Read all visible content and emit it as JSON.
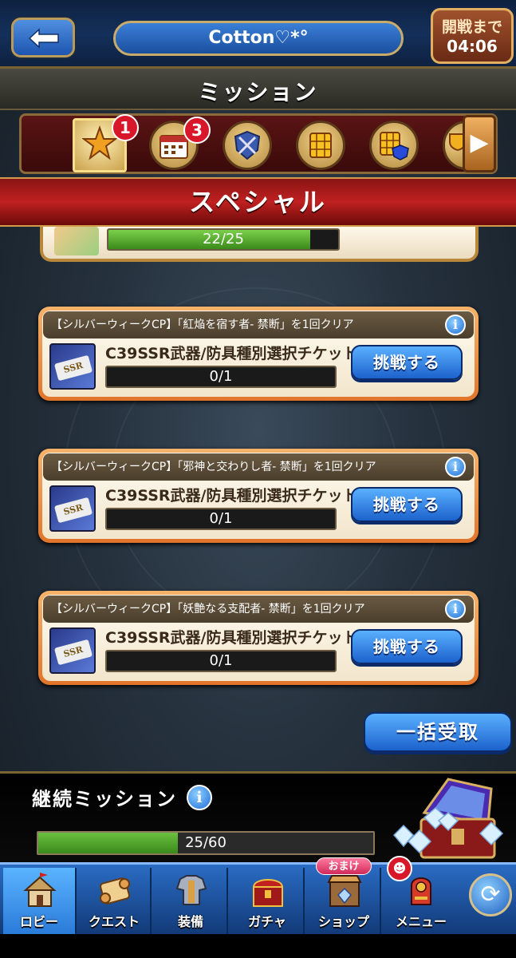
{
  "header": {
    "player_name": "Cotton♡*°",
    "timer_label": "開戦まで",
    "timer_value": "04:06"
  },
  "page_title": "ミッション",
  "tabs": [
    {
      "name": "special",
      "icon": "star-icon",
      "badge": "1",
      "active": true
    },
    {
      "name": "daily",
      "icon": "calendar-icon",
      "badge": "3",
      "active": false
    },
    {
      "name": "battle",
      "icon": "shield-swords-icon",
      "badge": "",
      "active": false
    },
    {
      "name": "panel",
      "icon": "grid-panel-icon",
      "badge": "",
      "active": false
    },
    {
      "name": "panel-gem",
      "icon": "grid-gem-icon",
      "badge": "",
      "active": false
    },
    {
      "name": "trophy",
      "icon": "trophy-icon",
      "badge": "",
      "active": false
    }
  ],
  "category_banner": "スペシャル",
  "partial_mission": {
    "progress_text": "22/25",
    "progress_fraction": 0.88
  },
  "missions": [
    {
      "title": "【シルバーウィークCP】「紅焔を宿す者- 禁断」を1回クリア",
      "reward": "C39SSR武器/防具種別選択チケット",
      "ticket_label": "SSR",
      "progress_text": "0/1",
      "progress_fraction": 0,
      "button": "挑戦する"
    },
    {
      "title": "【シルバーウィークCP】「邪神と交わりし者- 禁断」を1回クリア",
      "reward": "C39SSR武器/防具種別選択チケット",
      "ticket_label": "SSR",
      "progress_text": "0/1",
      "progress_fraction": 0,
      "button": "挑戦する"
    },
    {
      "title": "【シルバーウィークCP】「妖艶なる支配者- 禁断」を1回クリア",
      "reward": "C39SSR武器/防具種別選択チケット",
      "ticket_label": "SSR",
      "progress_text": "0/1",
      "progress_fraction": 0,
      "button": "挑戦する"
    }
  ],
  "claim_all_button": "一括受取",
  "continuation": {
    "title": "継続ミッション",
    "progress_text": "25/60",
    "progress_fraction": 0.4167
  },
  "bottom_nav": {
    "bonus_tag": "おまけ",
    "items": [
      {
        "label": "ロビー",
        "icon": "lobby-icon",
        "active": true
      },
      {
        "label": "クエスト",
        "icon": "quest-scroll-icon",
        "active": false
      },
      {
        "label": "装備",
        "icon": "armor-icon",
        "active": false
      },
      {
        "label": "ガチャ",
        "icon": "gacha-chest-icon",
        "active": false
      },
      {
        "label": "ショップ",
        "icon": "shop-icon",
        "active": false
      },
      {
        "label": "メニュー",
        "icon": "menu-icon",
        "active": false
      }
    ]
  },
  "colors": {
    "accent_blue": "#1c62cc",
    "banner_red": "#c02020",
    "card_orange": "#e0742a",
    "progress_green": "#3a8a1a",
    "badge_red": "#d8182a"
  }
}
